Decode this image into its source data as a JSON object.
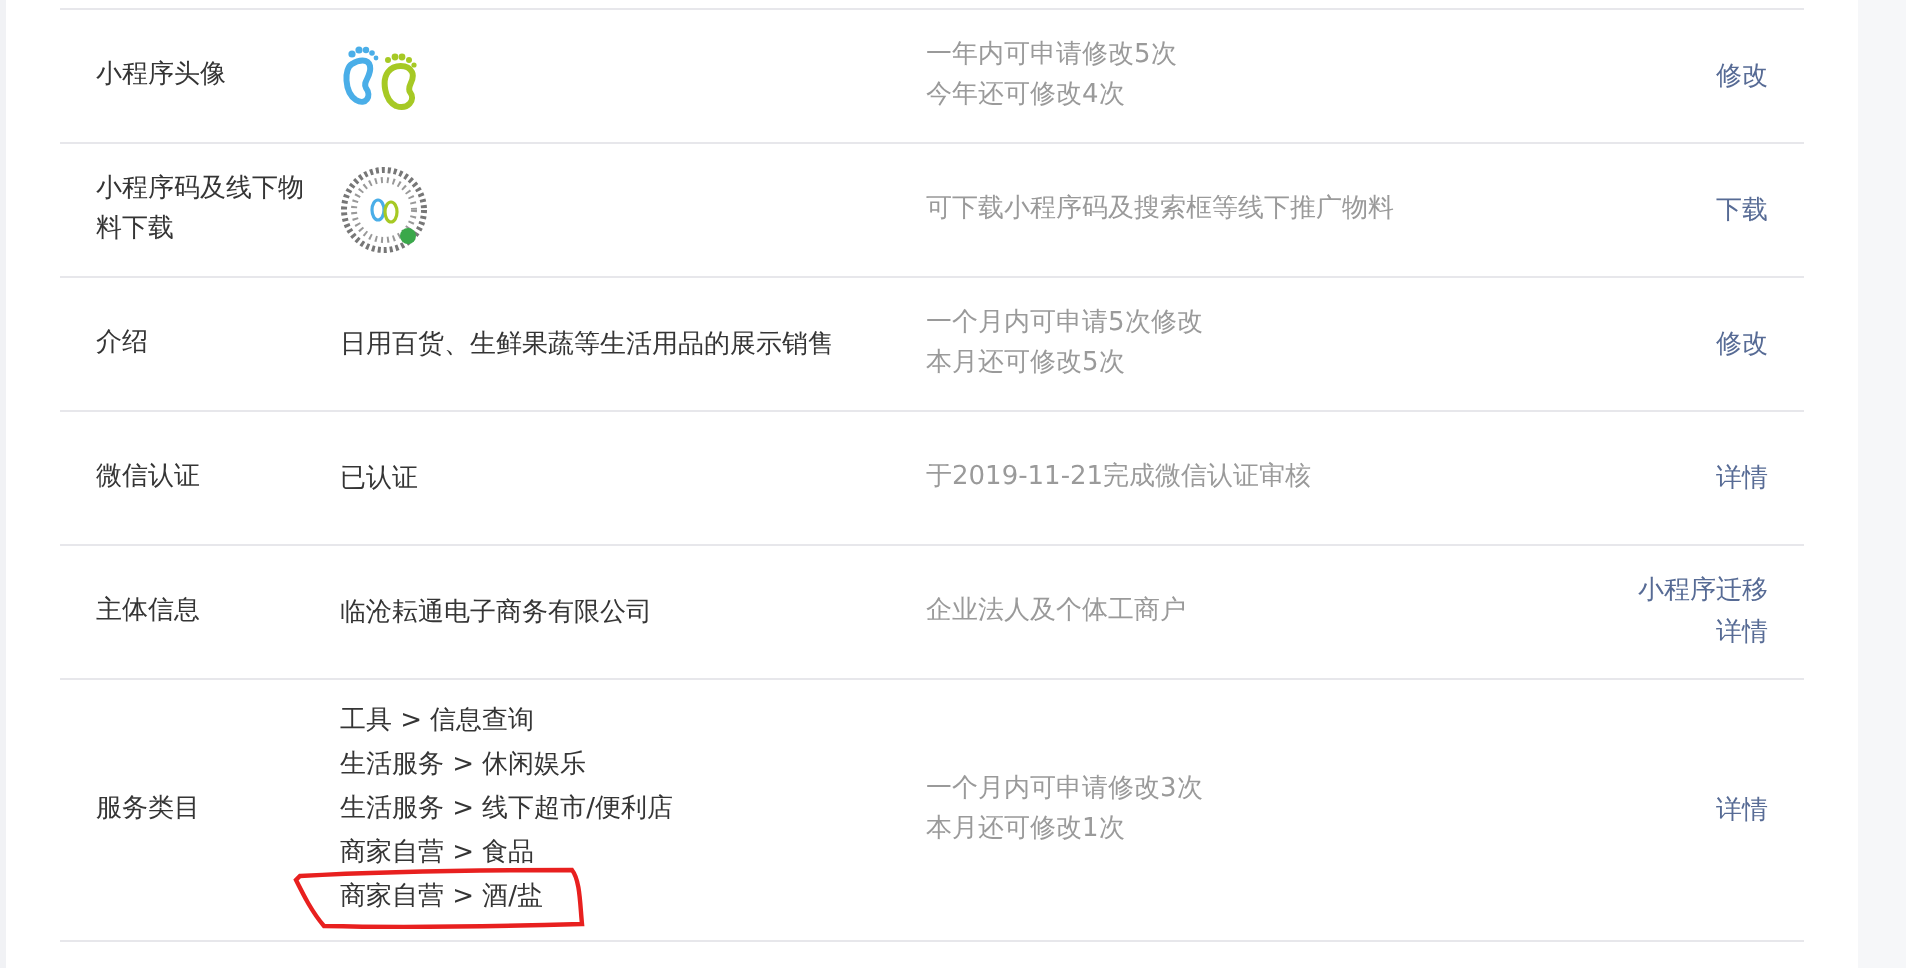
{
  "rows": [
    {
      "label": "小程序头像",
      "value": {
        "kind": "avatar"
      },
      "notes": [
        "一年内可申请修改5次",
        "今年还可修改4次"
      ],
      "actions": [
        "修改"
      ]
    },
    {
      "label": "小程序码及线下物料下载",
      "value": {
        "kind": "qrcode"
      },
      "notes": [
        "可下载小程序码及搜索框等线下推广物料"
      ],
      "actions": [
        "下载"
      ]
    },
    {
      "label": "介绍",
      "value": {
        "kind": "text",
        "text": "日用百货、生鲜果蔬等生活用品的展示销售"
      },
      "notes": [
        "一个月内可申请5次修改",
        "本月还可修改5次"
      ],
      "actions": [
        "修改"
      ]
    },
    {
      "label": "微信认证",
      "value": {
        "kind": "text",
        "text": "已认证"
      },
      "notes": [
        "于2019-11-21完成微信认证审核"
      ],
      "actions": [
        "详情"
      ]
    },
    {
      "label": "主体信息",
      "value": {
        "kind": "text",
        "text": "临沧耘通电子商务有限公司"
      },
      "notes": [
        "企业法人及个体工商户"
      ],
      "actions": [
        "小程序迁移",
        "详情"
      ]
    },
    {
      "label": "服务类目",
      "value": {
        "kind": "categories",
        "items": [
          {
            "text": "工具 > 信息查询",
            "highlighted": false
          },
          {
            "text": "生活服务 > 休闲娱乐",
            "highlighted": false
          },
          {
            "text": "生活服务 > 线下超市/便利店",
            "highlighted": false
          },
          {
            "text": "商家自营 > 食品",
            "highlighted": false
          },
          {
            "text": "商家自营 > 酒/盐",
            "highlighted": true
          }
        ]
      },
      "notes": [
        "一个月内可申请修改3次",
        "本月还可修改1次"
      ],
      "actions": [
        "详情"
      ]
    }
  ]
}
